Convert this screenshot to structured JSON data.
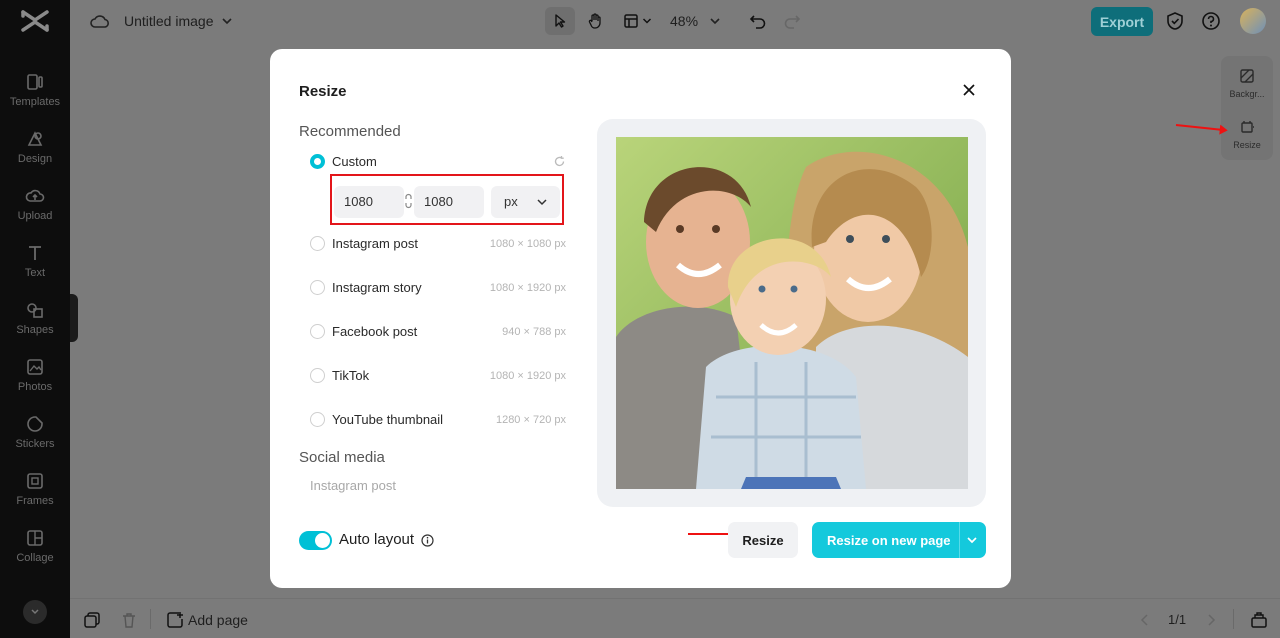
{
  "header": {
    "doc_title": "Untitled image",
    "zoom": "48%",
    "export_label": "Export"
  },
  "sidebar": {
    "items": [
      {
        "label": "Templates",
        "icon": "templates-icon"
      },
      {
        "label": "Design",
        "icon": "design-icon"
      },
      {
        "label": "Upload",
        "icon": "upload-icon"
      },
      {
        "label": "Text",
        "icon": "text-icon"
      },
      {
        "label": "Shapes",
        "icon": "shapes-icon"
      },
      {
        "label": "Photos",
        "icon": "photos-icon"
      },
      {
        "label": "Stickers",
        "icon": "stickers-icon"
      },
      {
        "label": "Frames",
        "icon": "frames-icon"
      },
      {
        "label": "Collage",
        "icon": "collage-icon"
      }
    ]
  },
  "right_panel": {
    "background_label": "Backgr...",
    "resize_label": "Resize"
  },
  "bottom": {
    "add_page_label": "Add page",
    "page_count": "1/1"
  },
  "modal": {
    "title": "Resize",
    "recommended_title": "Recommended",
    "custom_label": "Custom",
    "width_value": "1080",
    "height_value": "1080",
    "unit": "px",
    "options": [
      {
        "label": "Instagram post",
        "size": "1080 × 1080 px"
      },
      {
        "label": "Instagram story",
        "size": "1080 × 1920 px"
      },
      {
        "label": "Facebook post",
        "size": "940 × 788 px"
      },
      {
        "label": "TikTok",
        "size": "1080 × 1920 px"
      },
      {
        "label": "YouTube thumbnail",
        "size": "1280 × 720 px"
      }
    ],
    "social_title": "Social media",
    "social_first": "Instagram post",
    "auto_layout_label": "Auto layout",
    "auto_layout_on": true,
    "resize_label": "Resize",
    "resize_new_label": "Resize on new page"
  },
  "colors": {
    "accent": "#14c9dc",
    "highlight": "#e3151a",
    "export_bg": "#0e6e7a"
  }
}
